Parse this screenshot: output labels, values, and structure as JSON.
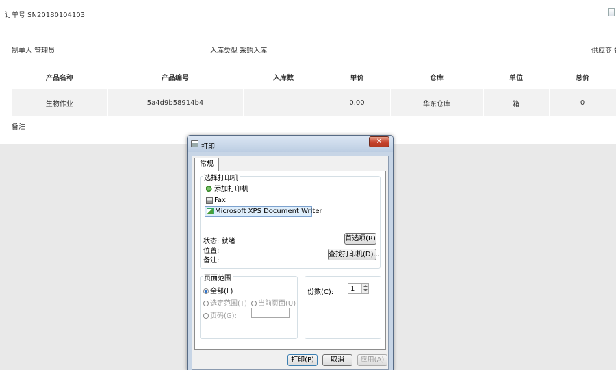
{
  "page": {
    "order_no": "订单号 SN20180104103",
    "maker": "制单人 管理员",
    "inbound_type": "入库类型 采购入库",
    "supplier": "供应商 数",
    "remark_label": "备注"
  },
  "table": {
    "headers": [
      "产品名称",
      "产品编号",
      "入库数",
      "单价",
      "仓库",
      "单位",
      "总价"
    ],
    "rows": [
      [
        "生物作业",
        "5a4d9b58914b4",
        "",
        "0.00",
        "华东仓库",
        "箱",
        "0"
      ]
    ]
  },
  "dialog": {
    "title": "打印",
    "close_symbol": "✕",
    "tab_general": "常规",
    "select_printer_label": "选择打印机",
    "printers": [
      "添加打印机",
      "Fax",
      "Microsoft XPS Document Writer"
    ],
    "status": "状态:   就绪",
    "location": "位置:",
    "comment": "备注:",
    "preferences_button": "首选项(R)",
    "find_printer_button": "查找打印机(D)...",
    "page_range_label": "页面范围",
    "range_all": "全部(L)",
    "range_selection": "选定范围(T)",
    "range_current": "当前页面(U)",
    "range_pages": "页码(G):",
    "copies_label": "份数(C):",
    "copies_value": "1",
    "print_button": "打印(P)",
    "cancel_button": "取消",
    "apply_button": "应用(A)"
  }
}
